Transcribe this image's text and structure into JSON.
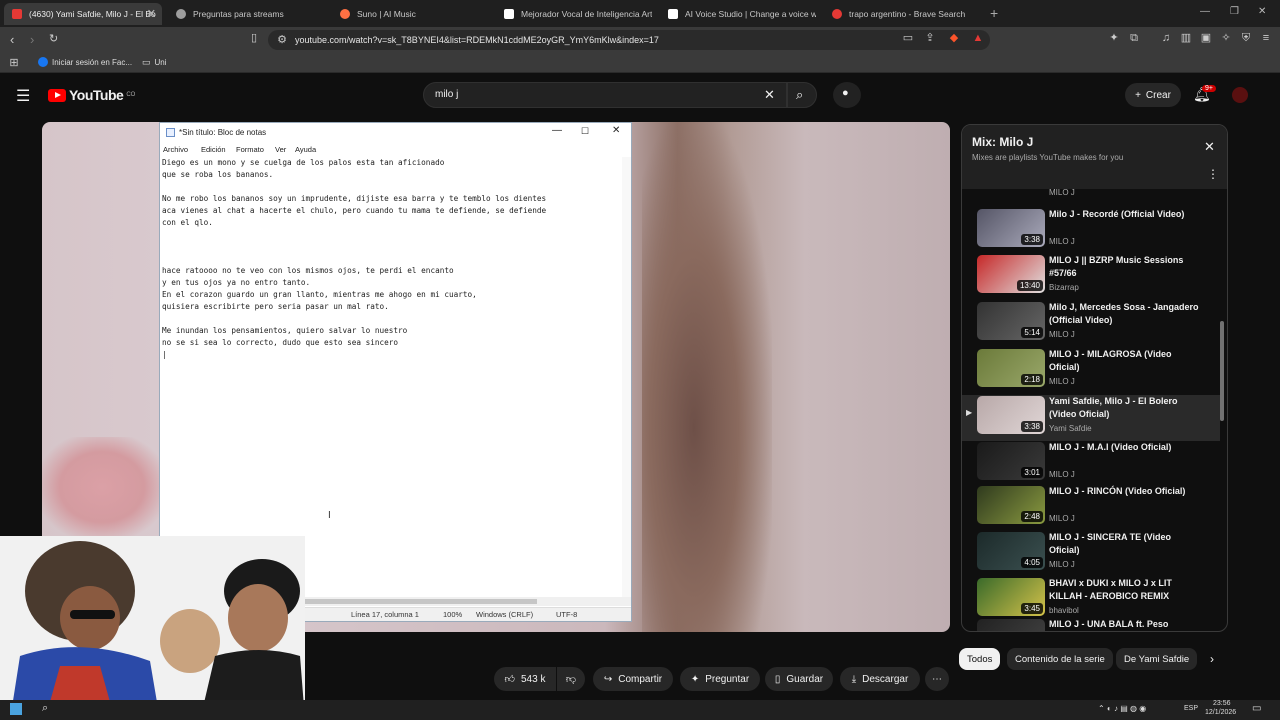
{
  "browser": {
    "tabs": [
      {
        "label": "(4630) Yami Safdie, Milo J - El Bo",
        "color": "#e53935"
      },
      {
        "label": "Preguntas para streams",
        "color": "#9e9e9e"
      },
      {
        "label": "Suno | AI Music",
        "color": "#ff7043"
      },
      {
        "label": "Mejorador Vocal de Inteligencia Arti",
        "color": "#ffffff"
      },
      {
        "label": "AI Voice Studio | Change a voice wit",
        "color": "#ffffff"
      },
      {
        "label": "trapo argentino - Brave Search",
        "color": "#e53935"
      }
    ],
    "url": "youtube.com/watch?v=sk_T8BYNEI4&list=RDEMkN1cddME2oyGR_YmY6mKlw&index=17",
    "bookmarks": [
      {
        "label": "Iniciar sesión en Fac..."
      },
      {
        "label": "Uni"
      }
    ]
  },
  "youtube": {
    "logo": "YouTube",
    "country": "CO",
    "search_value": "milo j",
    "create_label": "Crear",
    "notif_badge": "9+"
  },
  "notepad": {
    "title": "*Sin título: Bloc de notas",
    "menu": [
      "Archivo",
      "Edición",
      "Formato",
      "Ver",
      "Ayuda"
    ],
    "text": "Diego es un mono y se cuelga de los palos esta tan aficionado\nque se roba los bananos.\n\nNo me robo los bananos soy un imprudente, dijiste esa barra y te temblo los dientes\naca vienes al chat a hacerte el chulo, pero cuando tu mama te defiende, se defiende\ncon el qlo.\n\n\n\nhace ratoooo no te veo con los mismos ojos, te perdi el encanto\ny en tus ojos ya no entro tanto.\nEn el corazon guardo un gran llanto, mientras me ahogo en mi cuarto,\nquisiera escribirte pero seria pasar un mal rato.\n\nMe inundan los pensamientos, quiero salvar lo nuestro\nno se si sea lo correcto, dudo que esto sea sincero\n|",
    "status": {
      "position": "Línea 17, columna 1",
      "zoom": "100%",
      "eol": "Windows (CRLF)",
      "encoding": "UTF-8"
    }
  },
  "actions": {
    "likes": "543 k",
    "share": "Compartir",
    "ask": "Preguntar",
    "save": "Guardar",
    "download": "Descargar"
  },
  "playlist": {
    "title": "Mix: Milo J",
    "subtitle": "Mixes are playlists YouTube makes for you",
    "top_channel": "MILO J",
    "items": [
      {
        "title": "Milo J - Recordé (Official Video)",
        "channel": "MILO J",
        "duration": "3:38",
        "colors": [
          "#556",
          "#aab"
        ]
      },
      {
        "title": "MILO J || BZRP Music Sessions #57/66",
        "channel": "Bizarrap",
        "duration": "13:40",
        "colors": [
          "#c62828",
          "#e0e0e0"
        ]
      },
      {
        "title": "Milo J, Mercedes Sosa - Jangadero (Official Video)",
        "channel": "MILO J",
        "duration": "5:14",
        "colors": [
          "#333",
          "#666"
        ]
      },
      {
        "title": "MILO J - MILAGROSA (Video Oficial)",
        "channel": "MILO J",
        "duration": "2:18",
        "colors": [
          "#6b7a3a",
          "#9aa86a"
        ]
      },
      {
        "title": "Yami Safdie, Milo J - El Bolero (Video Oficial)",
        "channel": "Yami Safdie",
        "duration": "3:38",
        "colors": [
          "#b8a8a8",
          "#e0d6d6"
        ]
      },
      {
        "title": "MILO J - M.A.I (Video Oficial)",
        "channel": "MILO J",
        "duration": "3:01",
        "colors": [
          "#1a1a1a",
          "#3a3a3a"
        ]
      },
      {
        "title": "MILO J - RINCÓN (Video Oficial)",
        "channel": "MILO J",
        "duration": "2:48",
        "colors": [
          "#2f3a1e",
          "#8a9a40"
        ]
      },
      {
        "title": "MILO J - SINCERA TE (Video Oficial)",
        "channel": "MILO J",
        "duration": "4:05",
        "colors": [
          "#1c2a2a",
          "#3b5050"
        ]
      },
      {
        "title": "BHAVI x DUKI x MILO J x LIT KILLAH - AEROBICO REMIX",
        "channel": "bhavibol",
        "duration": "3:45",
        "colors": [
          "#3a6a2a",
          "#d4c24a"
        ]
      },
      {
        "title": "MILO J - UNA BALA ft. Peso",
        "channel": "",
        "duration": "",
        "colors": [
          "#222",
          "#444"
        ]
      }
    ]
  },
  "chips": [
    "Todos",
    "Contenido de la serie",
    "De Yami Safdie"
  ],
  "taskbar": {
    "time": "23:56",
    "date": "12/1/2026",
    "lang": "ESP"
  }
}
